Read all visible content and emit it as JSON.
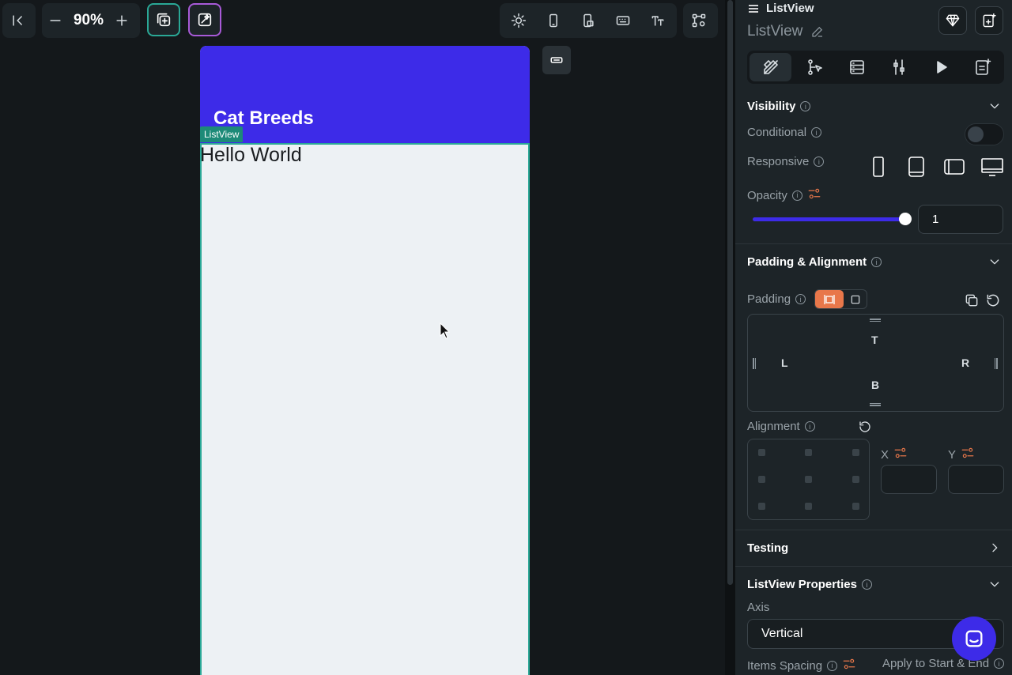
{
  "toolbar": {
    "zoom": "90%"
  },
  "canvas": {
    "appbar_title": "Cat Breeds",
    "selected_tag": "ListView",
    "text_widget": "Hello World",
    "appbar_color": "#3d2be8",
    "selection_color": "#2aa896"
  },
  "panel": {
    "widget_type": "ListView",
    "widget_name": "ListView",
    "visibility": {
      "title": "Visibility",
      "conditional_label": "Conditional",
      "responsive_label": "Responsive",
      "opacity_label": "Opacity",
      "opacity_value": "1",
      "opacity_fraction": 1
    },
    "padding_alignment": {
      "title": "Padding & Alignment",
      "padding_label": "Padding",
      "top": "T",
      "left": "L",
      "right": "R",
      "bottom": "B",
      "alignment_label": "Alignment",
      "x_label": "X",
      "y_label": "Y"
    },
    "testing": {
      "title": "Testing"
    },
    "listview_properties": {
      "title": "ListView Properties",
      "axis_label": "Axis",
      "axis_value": "Vertical",
      "items_spacing_label": "Items Spacing",
      "apply_label": "Apply to Start & End"
    }
  },
  "colors": {
    "accent_orange": "#e8774a",
    "primary_purple": "#3d2be8"
  }
}
